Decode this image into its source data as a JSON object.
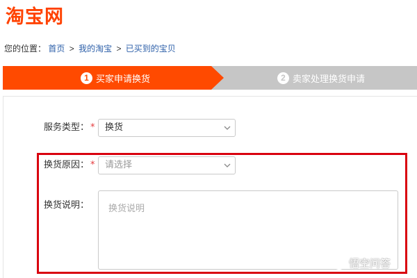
{
  "site": {
    "logo": "淘宝网"
  },
  "breadcrumb": {
    "prefix": "您的位置：",
    "items": [
      "首页",
      "我的淘宝",
      "已买到的宝贝"
    ],
    "separator": ">"
  },
  "steps": [
    {
      "number": "1",
      "label": "买家申请换货",
      "active": true
    },
    {
      "number": "2",
      "label": "卖家处理换货申请",
      "active": false
    }
  ],
  "form": {
    "service_type": {
      "label": "服务类型：",
      "required_mark": "*",
      "value": "换货"
    },
    "reason": {
      "label": "换货原因：",
      "required_mark": "*",
      "placeholder": "请选择"
    },
    "description": {
      "label": "换货说明：",
      "placeholder": "换货说明"
    }
  },
  "watermark": {
    "text": "悟空问答"
  },
  "colors": {
    "brand": "#ff4200",
    "active_step": "#ff4a00",
    "inactive_step": "#c6c6c6",
    "link": "#2b5ea8",
    "required": "#e4393c",
    "highlight_border": "#d9000f"
  }
}
